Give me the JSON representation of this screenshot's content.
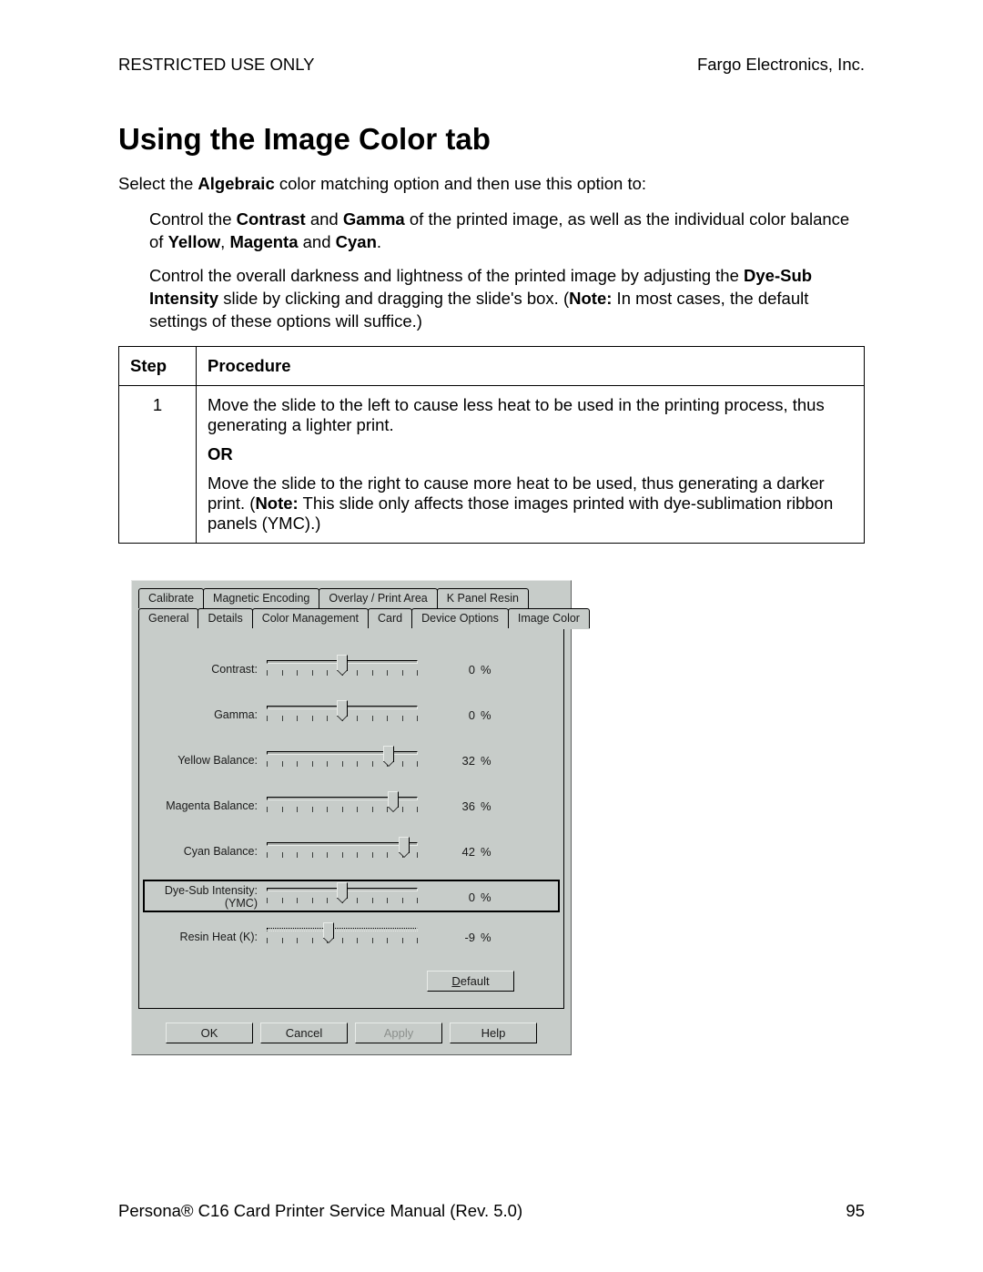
{
  "header": {
    "left": "RESTRICTED USE ONLY",
    "right": "Fargo Electronics, Inc."
  },
  "title": "Using the Image Color tab",
  "intro": {
    "line": "Select the ",
    "bold1": "Algebraic",
    "line_after": " color matching option and then use this option to:"
  },
  "bullet1": {
    "pre": "Control the ",
    "b1": "Contrast",
    "mid1": " and ",
    "b2": "Gamma",
    "mid2": " of the printed image, as well as the individual color balance of ",
    "b3": "Yellow",
    "c1": ", ",
    "b4": "Magenta",
    "c2": " and ",
    "b5": "Cyan",
    "end": "."
  },
  "bullet2": {
    "pre": "Control the overall darkness and lightness of the printed image by adjusting the ",
    "b1": "Dye-Sub Intensity",
    "mid": " slide by clicking and dragging the slide's box. (",
    "note_lbl": "Note:",
    "note": " In most cases, the default settings of these options will suffice.)"
  },
  "table": {
    "head_step": "Step",
    "head_proc": "Procedure",
    "step1_num": "1",
    "p1": "Move the slide to the left to cause less heat to be used in the printing process, thus generating a lighter print.",
    "or": "OR",
    "p2_pre": "Move the slide to the right to cause more heat to be used, thus generating a darker print. (",
    "p2_note_lbl": "Note:",
    "p2_post": "  This slide only affects those images printed with dye-sublimation ribbon panels (YMC).)"
  },
  "dialog": {
    "tabs_row1": [
      "Calibrate",
      "Magnetic Encoding",
      "Overlay / Print Area",
      "K Panel Resin"
    ],
    "tabs_row2": [
      "General",
      "Details",
      "Color Management",
      "Card",
      "Device Options",
      "Image Color"
    ],
    "selected_tab": "Image Color",
    "sliders": [
      {
        "label": "Contrast:",
        "value": "0",
        "thumb_pct": 50
      },
      {
        "label": "Gamma:",
        "value": "0",
        "thumb_pct": 50
      },
      {
        "label": "Yellow Balance:",
        "value": "32",
        "thumb_pct": 80
      },
      {
        "label": "Magenta Balance:",
        "value": "36",
        "thumb_pct": 83
      },
      {
        "label": "Cyan Balance:",
        "value": "42",
        "thumb_pct": 90
      },
      {
        "label": "Dye-Sub Intensity:\n(YMC)",
        "value": "0",
        "thumb_pct": 50,
        "boxed": true
      },
      {
        "label": "Resin Heat  (K):",
        "value": "-9",
        "thumb_pct": 41,
        "dotted": true
      }
    ],
    "pct": "%",
    "default_btn_accel": "D",
    "default_btn_rest": "efault",
    "buttons": {
      "ok": "OK",
      "cancel": "Cancel",
      "apply": "Apply",
      "help": "Help"
    }
  },
  "footer": {
    "left_pre": "Persona",
    "reg": "®",
    "left_post": " C16 Card Printer Service Manual (Rev. 5.0)",
    "page": "95"
  }
}
